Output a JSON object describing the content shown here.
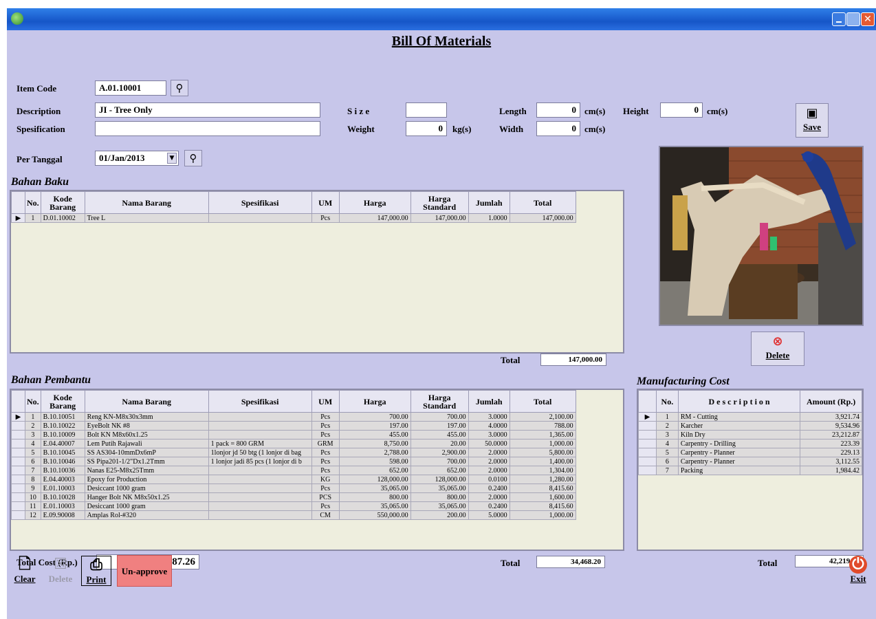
{
  "window": {
    "close_glyph": "✕"
  },
  "form": {
    "title": "Bill Of Materials",
    "item_code_label": "Item Code",
    "item_code_value": "A.01.10001",
    "description_label": "Description",
    "description_value": "JI - Tree Only",
    "spesification_label": "Spesification",
    "spesification_value": "",
    "size_label": "S i z e",
    "size_value": "",
    "weight_label": "Weight",
    "weight_value": "0",
    "weight_unit": "kg(s)",
    "length_label": "Length",
    "length_value": "0",
    "length_unit": "cm(s)",
    "width_label": "Width",
    "width_value": "0",
    "width_unit": "cm(s)",
    "height_label": "Height",
    "height_value": "0",
    "height_unit": "cm(s)",
    "per_tanggal_label": "Per Tanggal",
    "per_tanggal_value": "01/Jan/2013",
    "save_label": "Save",
    "delete_label": "Delete"
  },
  "bahan_baku": {
    "title": "Bahan Baku",
    "columns": [
      "No.",
      "Kode Barang",
      "Nama Barang",
      "Spesifikasi",
      "UM",
      "Harga",
      "Harga Standard",
      "Jumlah",
      "Total"
    ],
    "rows": [
      [
        "1",
        "D.01.10002",
        "Tree L",
        "",
        "Pcs",
        "147,000.00",
        "147,000.00",
        "1.0000",
        "147,000.00"
      ]
    ],
    "total_label": "Total",
    "total_value": "147,000.00"
  },
  "bahan_pembantu": {
    "title": "Bahan Pembantu",
    "columns": [
      "No.",
      "Kode Barang",
      "Nama Barang",
      "Spesifikasi",
      "UM",
      "Harga",
      "Harga Standard",
      "Jumlah",
      "Total"
    ],
    "rows": [
      [
        "1",
        "B.10.10051",
        "Reng KN-M8x30x3mm",
        "",
        "Pcs",
        "700.00",
        "700.00",
        "3.0000",
        "2,100.00"
      ],
      [
        "2",
        "B.10.10022",
        "EyeBolt NK #8",
        "",
        "Pcs",
        "197.00",
        "197.00",
        "4.0000",
        "788.00"
      ],
      [
        "3",
        "B.10.10009",
        "Bolt KN M8x60x1.25",
        "",
        "Pcs",
        "455.00",
        "455.00",
        "3.0000",
        "1,365.00"
      ],
      [
        "4",
        "E.04.40007",
        "Lem Putih Rajawali",
        "1 pack = 800 GRM",
        "GRM",
        "8,750.00",
        "20.00",
        "50.0000",
        "1,000.00"
      ],
      [
        "5",
        "B.10.10045",
        "SS AS304-10mmDx6mP",
        "1lonjor jd 50 btg (1 lonjor di bag",
        "Pcs",
        "2,788.00",
        "2,900.00",
        "2.0000",
        "5,800.00"
      ],
      [
        "6",
        "B.10.10046",
        "SS Pipa201-1/2\"Dx1.2Tmm",
        "1 lonjor jadi 85 pcs (1 lonjor di b",
        "Pcs",
        "598.00",
        "700.00",
        "2.0000",
        "1,400.00"
      ],
      [
        "7",
        "B.10.10036",
        "Nanas E25-M8x25Tmm",
        "",
        "Pcs",
        "652.00",
        "652.00",
        "2.0000",
        "1,304.00"
      ],
      [
        "8",
        "E.04.40003",
        "Epoxy for Production",
        "",
        "KG",
        "128,000.00",
        "128,000.00",
        "0.0100",
        "1,280.00"
      ],
      [
        "9",
        "E.01.10003",
        "Desiccant 1000 gram",
        "",
        "Pcs",
        "35,065.00",
        "35,065.00",
        "0.2400",
        "8,415.60"
      ],
      [
        "10",
        "B.10.10028",
        "Hanger Bolt NK M8x50x1.25",
        "",
        "PCS",
        "800.00",
        "800.00",
        "2.0000",
        "1,600.00"
      ],
      [
        "11",
        "E.01.10003",
        "Desiccant 1000 gram",
        "",
        "Pcs",
        "35,065.00",
        "35,065.00",
        "0.2400",
        "8,415.60"
      ],
      [
        "12",
        "E.09.90008",
        "Amplas Rol-#320",
        "",
        "CM",
        "550,000.00",
        "200.00",
        "5.0000",
        "1,000.00"
      ]
    ],
    "total_label": "Total",
    "total_value": "34,468.20"
  },
  "manufacturing_cost": {
    "title": "Manufacturing Cost",
    "columns": [
      "No.",
      "D e s c r i p t i o n",
      "Amount (Rp.)"
    ],
    "rows": [
      [
        "1",
        "RM - Cutting",
        "3,921.74"
      ],
      [
        "2",
        "Karcher",
        "9,534.96"
      ],
      [
        "3",
        "Kiln Dry",
        "23,212.87"
      ],
      [
        "4",
        "Carpentry - Drilling",
        "223.39"
      ],
      [
        "5",
        "Carpentry - Planner",
        "229.13"
      ],
      [
        "6",
        "Carpentry - Planner",
        "3,112.55"
      ],
      [
        "7",
        "Packing",
        "1,984.42"
      ]
    ],
    "total_label": "Total",
    "total_value": "42,219.06"
  },
  "total_cost": {
    "label": "Total Cost (Rp.)",
    "value": "223,687.26"
  },
  "toolbar": {
    "clear_label": "Clear",
    "delete_label": "Delete",
    "print_label": "Print",
    "unapprove_label": "Un-approve",
    "exit_label": "Exit"
  },
  "colors": {
    "form_bg": "#c7c6ea",
    "titlebar": "#1656c8",
    "unapprove": "#f08080"
  }
}
